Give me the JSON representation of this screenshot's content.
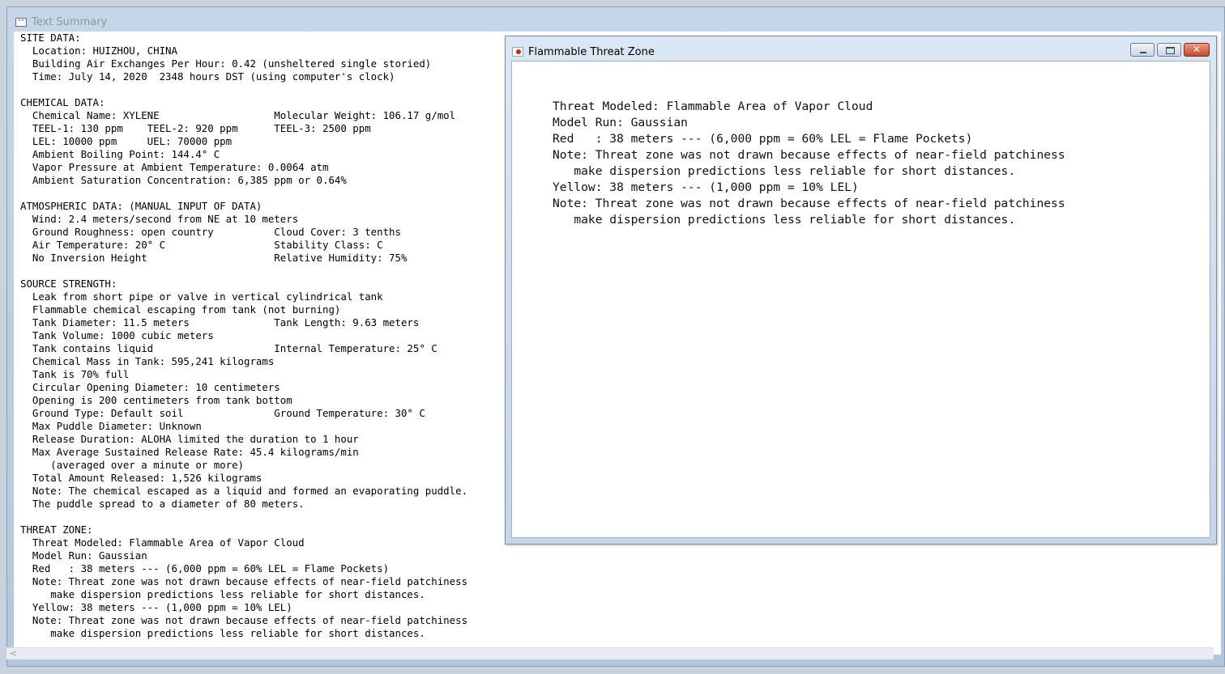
{
  "main_window": {
    "title": "Text Summary",
    "icon_text": "\"\""
  },
  "summary_lines": [
    "SITE DATA:",
    "  Location: HUIZHOU, CHINA",
    "  Building Air Exchanges Per Hour: 0.42 (unsheltered single storied)",
    "  Time: July 14, 2020  2348 hours DST (using computer's clock)",
    "",
    "CHEMICAL DATA:",
    "  Chemical Name: XYLENE                   Molecular Weight: 106.17 g/mol",
    "  TEEL-1: 130 ppm    TEEL-2: 920 ppm      TEEL-3: 2500 ppm",
    "  LEL: 10000 ppm     UEL: 70000 ppm",
    "  Ambient Boiling Point: 144.4° C",
    "  Vapor Pressure at Ambient Temperature: 0.0064 atm",
    "  Ambient Saturation Concentration: 6,385 ppm or 0.64%",
    "",
    "ATMOSPHERIC DATA: (MANUAL INPUT OF DATA)",
    "  Wind: 2.4 meters/second from NE at 10 meters",
    "  Ground Roughness: open country          Cloud Cover: 3 tenths",
    "  Air Temperature: 20° C                  Stability Class: C",
    "  No Inversion Height                     Relative Humidity: 75%",
    "",
    "SOURCE STRENGTH:",
    "  Leak from short pipe or valve in vertical cylindrical tank",
    "  Flammable chemical escaping from tank (not burning)",
    "  Tank Diameter: 11.5 meters              Tank Length: 9.63 meters",
    "  Tank Volume: 1000 cubic meters",
    "  Tank contains liquid                    Internal Temperature: 25° C",
    "  Chemical Mass in Tank: 595,241 kilograms",
    "  Tank is 70% full",
    "  Circular Opening Diameter: 10 centimeters",
    "  Opening is 200 centimeters from tank bottom",
    "  Ground Type: Default soil               Ground Temperature: 30° C",
    "  Max Puddle Diameter: Unknown",
    "  Release Duration: ALOHA limited the duration to 1 hour",
    "  Max Average Sustained Release Rate: 45.4 kilograms/min",
    "     (averaged over a minute or more)",
    "  Total Amount Released: 1,526 kilograms",
    "  Note: The chemical escaped as a liquid and formed an evaporating puddle.",
    "  The puddle spread to a diameter of 80 meters.",
    "",
    "THREAT ZONE:",
    "  Threat Modeled: Flammable Area of Vapor Cloud",
    "  Model Run: Gaussian",
    "  Red   : 38 meters --- (6,000 ppm = 60% LEL = Flame Pockets)",
    "  Note: Threat zone was not drawn because effects of near-field patchiness",
    "     make dispersion predictions less reliable for short distances.",
    "  Yellow: 38 meters --- (1,000 ppm = 10% LEL)",
    "  Note: Threat zone was not drawn because effects of near-field patchiness",
    "     make dispersion predictions less reliable for short distances."
  ],
  "threat_window": {
    "title": "Flammable Threat Zone",
    "close_label": "✕",
    "lines": [
      "Threat Modeled: Flammable Area of Vapor Cloud",
      "Model Run: Gaussian",
      "Red   : 38 meters --- (6,000 ppm = 60% LEL = Flame Pockets)",
      "Note: Threat zone was not drawn because effects of near-field patchiness",
      "   make dispersion predictions less reliable for short distances.",
      "Yellow: 38 meters --- (1,000 ppm = 10% LEL)",
      "Note: Threat zone was not drawn because effects of near-field patchiness",
      "   make dispersion predictions less reliable for short distances."
    ]
  },
  "scrollbar": {
    "left_arrow": "<"
  }
}
